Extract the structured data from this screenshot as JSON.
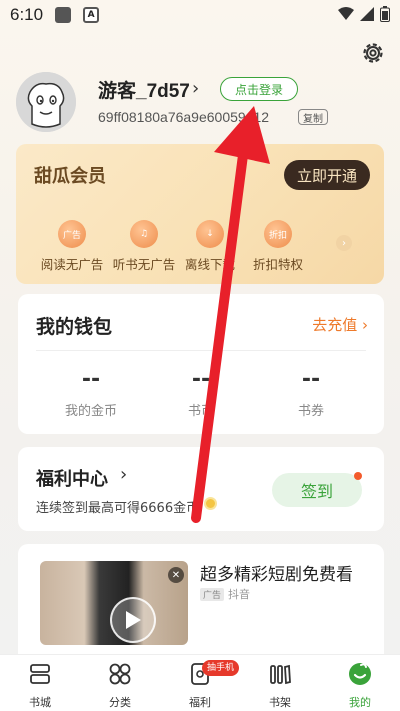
{
  "status_bar": {
    "time": "6:10",
    "notification_badge": "A"
  },
  "profile": {
    "username": "游客_7d57",
    "login_button": "点击登录",
    "user_id": "69ff08180a76a9e60059a12",
    "copy_label": "复制"
  },
  "vip": {
    "title": "甜瓜会员",
    "open_button": "立即开通",
    "perks": [
      {
        "label": "阅读无广告",
        "icon": "no-ad-icon",
        "icon_text": "广告"
      },
      {
        "label": "听书无广告",
        "icon": "headphone-icon",
        "icon_text": "♫"
      },
      {
        "label": "离线下载",
        "icon": "download-icon",
        "icon_text": "↓"
      },
      {
        "label": "折扣特权",
        "icon": "discount-icon",
        "icon_text": "折扣"
      }
    ]
  },
  "wallet": {
    "title": "我的钱包",
    "recharge": "去充值",
    "stats": [
      {
        "value": "--",
        "label": "我的金币"
      },
      {
        "value": "--",
        "label": "书币"
      },
      {
        "value": "--",
        "label": "书券"
      }
    ]
  },
  "welfare": {
    "title": "福利中心",
    "subtitle": "连续签到最高可得6666金币",
    "checkin_button": "签到"
  },
  "drama": {
    "title": "超多精彩短剧免费看",
    "ad_tag": "广告",
    "source": "抖音"
  },
  "tabbar": {
    "badge": "抽手机",
    "tabs": [
      {
        "label": "书城",
        "icon": "bookstore-icon"
      },
      {
        "label": "分类",
        "icon": "category-icon"
      },
      {
        "label": "福利",
        "icon": "welfare-icon"
      },
      {
        "label": "书架",
        "icon": "bookshelf-icon"
      },
      {
        "label": "我的",
        "icon": "profile-icon",
        "active": true
      }
    ]
  },
  "colors": {
    "accent_green": "#3aa33a",
    "accent_orange": "#ee7a2b",
    "annotation_arrow": "#e8202a"
  }
}
